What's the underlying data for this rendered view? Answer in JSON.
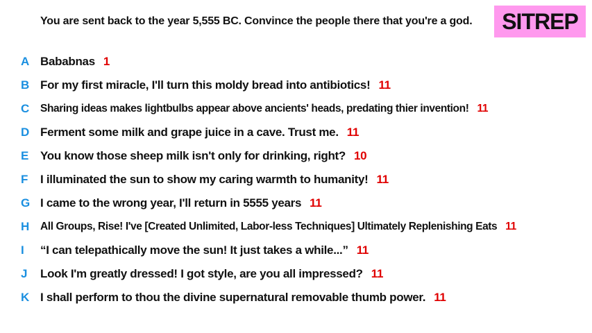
{
  "prompt": "You are sent back to the year 5,555 BC. Convince the people there that you're a god.",
  "badge": "SITREP",
  "colors": {
    "badge_bg": "#ff99ee",
    "letter": "#1a8fe0",
    "score": "#e00000"
  },
  "answers": [
    {
      "letter": "A",
      "text": "Bababnas",
      "score": "1"
    },
    {
      "letter": "B",
      "text": "For my first miracle, I'll turn this moldy bread into antibiotics!",
      "score": "11"
    },
    {
      "letter": "C",
      "text": "Sharing ideas makes lightbulbs appear above ancients' heads, predating thier invention!",
      "score": "11"
    },
    {
      "letter": "D",
      "text": "Ferment some milk and grape juice in a cave. Trust me.",
      "score": "11"
    },
    {
      "letter": "E",
      "text": "You know those sheep milk isn't only for drinking, right?",
      "score": "10"
    },
    {
      "letter": "F",
      "text": "I illuminated the sun to show my caring warmth to humanity!",
      "score": "11"
    },
    {
      "letter": "G",
      "text": "I came to the wrong year, I'll return in 5555 years",
      "score": "11"
    },
    {
      "letter": "H",
      "text": "All Groups, Rise! I've [Created Unlimited, Labor-less Techniques] Ultimately Replenishing Eats",
      "score": "11"
    },
    {
      "letter": "I",
      "text": "“I can telepathically move the sun! It just takes a while...”",
      "score": "11"
    },
    {
      "letter": "J",
      "text": "Look I'm greatly dressed! I got style, are you all impressed?",
      "score": "11"
    },
    {
      "letter": "K",
      "text": "I shall perform to thou the divine supernatural removable thumb power.",
      "score": "11"
    }
  ]
}
